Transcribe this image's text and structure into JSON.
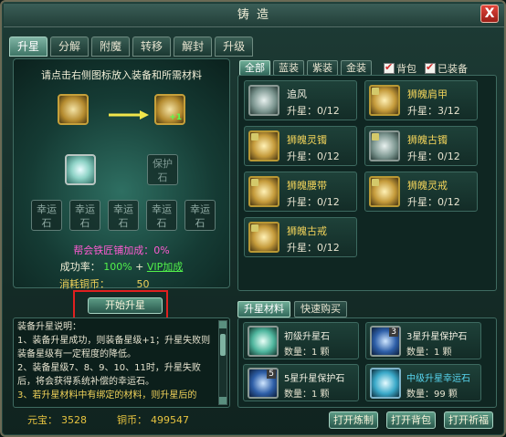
{
  "window": {
    "title": "铸 造",
    "close_label": "X"
  },
  "tabs": [
    {
      "label": "升星",
      "active": true
    },
    {
      "label": "分解"
    },
    {
      "label": "附魔"
    },
    {
      "label": "转移"
    },
    {
      "label": "解封"
    },
    {
      "label": "升级"
    }
  ],
  "forge": {
    "instruction": "请点击右侧图标放入装备和所需材料",
    "target_badge": "+1",
    "protect_slot_label": "保护石",
    "luck_slot_label": "幸运石",
    "guild_bonus": "帮会铁匠铺加成：0%",
    "success_label": "成功率：",
    "success_value": "100%",
    "plus": "+",
    "vip_label": "VIP加成",
    "cost_label": "消耗铜币：",
    "cost_value": "50",
    "start_button": "开始升星"
  },
  "description": {
    "lines": [
      "装备升星说明：",
      "1、装备升星成功，则装备星级+1；升星失败则装备星级有一定程度的降低。",
      "2、装备星级7、8、9、10、11时，升星失败后，将会获得系统补偿的幸运石。",
      "3、若升星材料中有绑定的材料，则升星后的"
    ]
  },
  "currency": {
    "yuanbao_label": "元宝：",
    "yuanbao_value": "3528",
    "copper_label": "铜币：",
    "copper_value": "499547"
  },
  "filters": {
    "buttons": [
      "全部",
      "蓝装",
      "紫装",
      "金装"
    ],
    "active": "全部",
    "bag_label": "背包",
    "equipped_label": "已装备"
  },
  "equipment": [
    {
      "name": "追风",
      "level_text": "升星：0/12",
      "color": "white"
    },
    {
      "name": "狮魄肩甲",
      "level_text": "升星：3/12",
      "color": "gold"
    },
    {
      "name": "狮魄灵镯",
      "level_text": "升星：0/12",
      "color": "gold"
    },
    {
      "name": "狮魄古镯",
      "level_text": "升星：0/12",
      "color": "gold"
    },
    {
      "name": "狮魄腰带",
      "level_text": "升星：0/12",
      "color": "gold"
    },
    {
      "name": "狮魄灵戒",
      "level_text": "升星：0/12",
      "color": "gold"
    },
    {
      "name": "狮魄古戒",
      "level_text": "升星：0/12",
      "color": "gold"
    }
  ],
  "materials": {
    "tabs": [
      "升星材料",
      "快速购买"
    ],
    "items": [
      {
        "name": "初级升星石",
        "qty": "数量：1 颗",
        "badge": ""
      },
      {
        "name": "3星升星保护石",
        "qty": "数量：1 颗",
        "badge": "3"
      },
      {
        "name": "5星升星保护石",
        "qty": "数量：1 颗",
        "badge": "5"
      },
      {
        "name": "中级升星幸运石",
        "qty": "数量：99 颗",
        "badge": ""
      }
    ]
  },
  "footer_buttons": [
    "打开炼制",
    "打开背包",
    "打开祈福"
  ]
}
